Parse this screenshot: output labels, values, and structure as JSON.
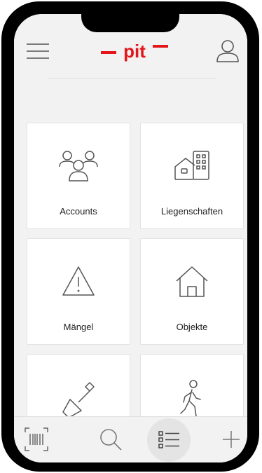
{
  "header": {
    "logo_text": "pit",
    "icons": {
      "menu": "hamburger-menu-icon",
      "user": "user-profile-icon"
    },
    "brand_color": "#e3161b"
  },
  "tiles": [
    {
      "label": "Accounts",
      "icon": "users-group-icon"
    },
    {
      "label": "Liegenschaften",
      "icon": "house-building-icon"
    },
    {
      "label": "Mängel",
      "icon": "warning-triangle-icon"
    },
    {
      "label": "Objekte",
      "icon": "house-icon"
    },
    {
      "label": "",
      "icon": "shovel-icon"
    },
    {
      "label": "",
      "icon": "walking-person-icon"
    }
  ],
  "bottom_nav": {
    "active": "list",
    "items": [
      "barcode-scan-icon",
      "search-icon",
      "list-icon",
      "plus-icon"
    ]
  }
}
